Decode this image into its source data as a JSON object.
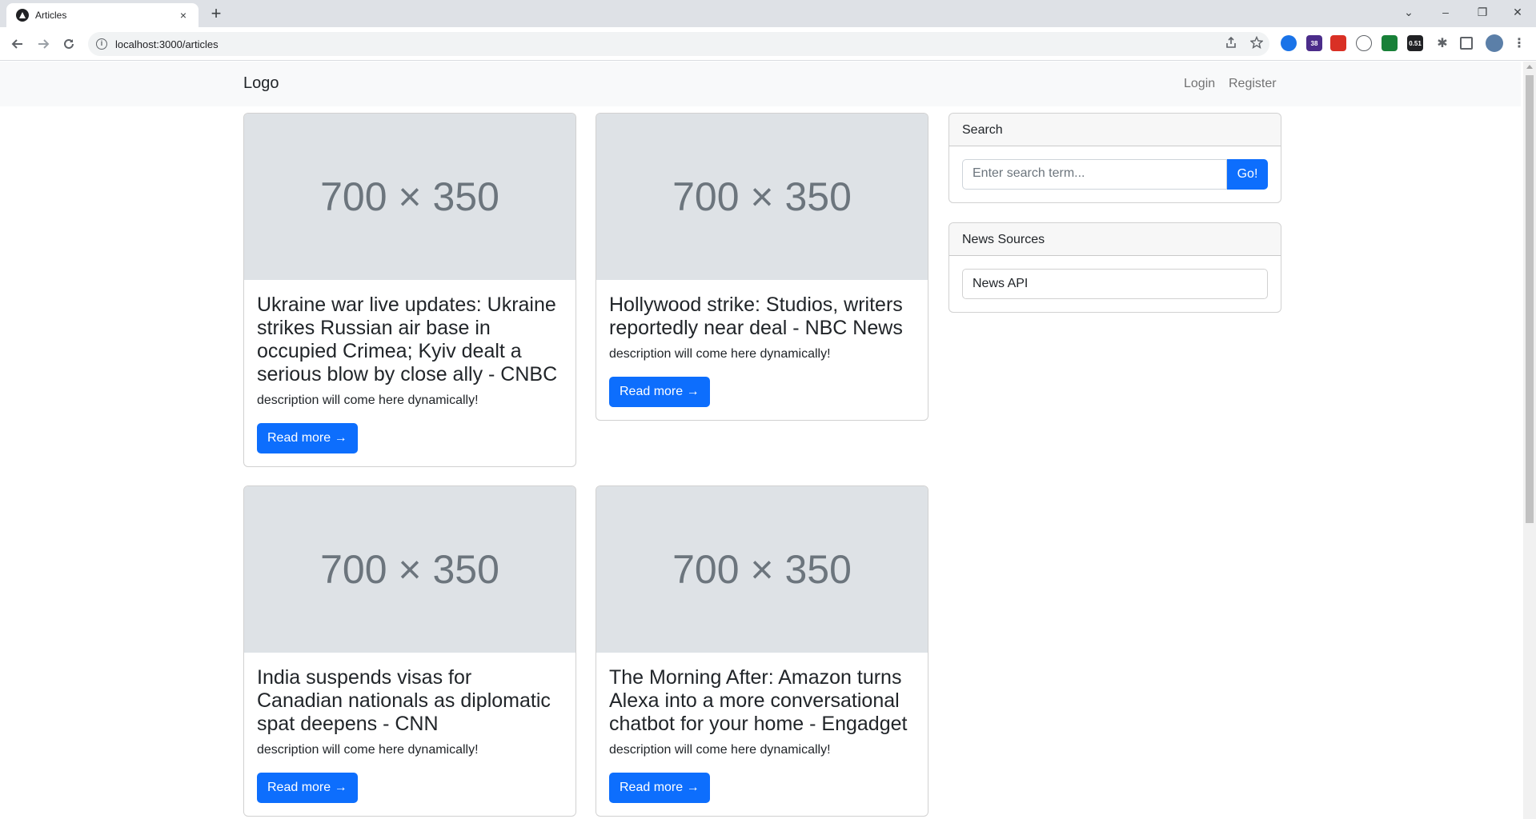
{
  "browser": {
    "tab_title": "Articles",
    "tab_close": "×",
    "new_tab": "+",
    "url": "localhost:3000/articles",
    "window_controls": {
      "dropdown": "⌄",
      "minimize": "–",
      "restore": "❐",
      "close": "✕"
    },
    "extensions": [
      {
        "name": "extension-blue-icon",
        "color": "#1a73e8",
        "badge": ""
      },
      {
        "name": "extension-grad-cap-icon",
        "color": "#4b2c8a",
        "badge": "38"
      },
      {
        "name": "extension-red-icon",
        "color": "#d93025",
        "badge": ""
      },
      {
        "name": "extension-circle-icon",
        "color": "#5f6368",
        "badge": ""
      },
      {
        "name": "extension-green-icon",
        "color": "#188038",
        "badge": ""
      },
      {
        "name": "extension-cls-icon",
        "color": "#202124",
        "badge": "0.51"
      }
    ]
  },
  "navbar": {
    "brand": "Logo",
    "links": [
      "Login",
      "Register"
    ]
  },
  "articles": [
    {
      "placeholder": "700 × 350",
      "title": "Ukraine war live updates: Ukraine strikes Russian air base in occupied Crimea; Kyiv dealt a serious blow by close ally - CNBC",
      "description": "description will come here dynamically!",
      "button": "Read more →"
    },
    {
      "placeholder": "700 × 350",
      "title": "Hollywood strike: Studios, writers reportedly near deal - NBC News",
      "description": "description will come here dynamically!",
      "button": "Read more →"
    },
    {
      "placeholder": "700 × 350",
      "title": "India suspends visas for Canadian nationals as diplomatic spat deepens - CNN",
      "description": "description will come here dynamically!",
      "button": "Read more →"
    },
    {
      "placeholder": "700 × 350",
      "title": "The Morning After: Amazon turns Alexa into a more conversational chatbot for your home - Engadget",
      "description": "description will come here dynamically!",
      "button": "Read more →"
    }
  ],
  "sidebar": {
    "search": {
      "header": "Search",
      "placeholder": "Enter search term...",
      "button": "Go!"
    },
    "sources": {
      "header": "News Sources",
      "items": [
        "News API"
      ]
    }
  }
}
